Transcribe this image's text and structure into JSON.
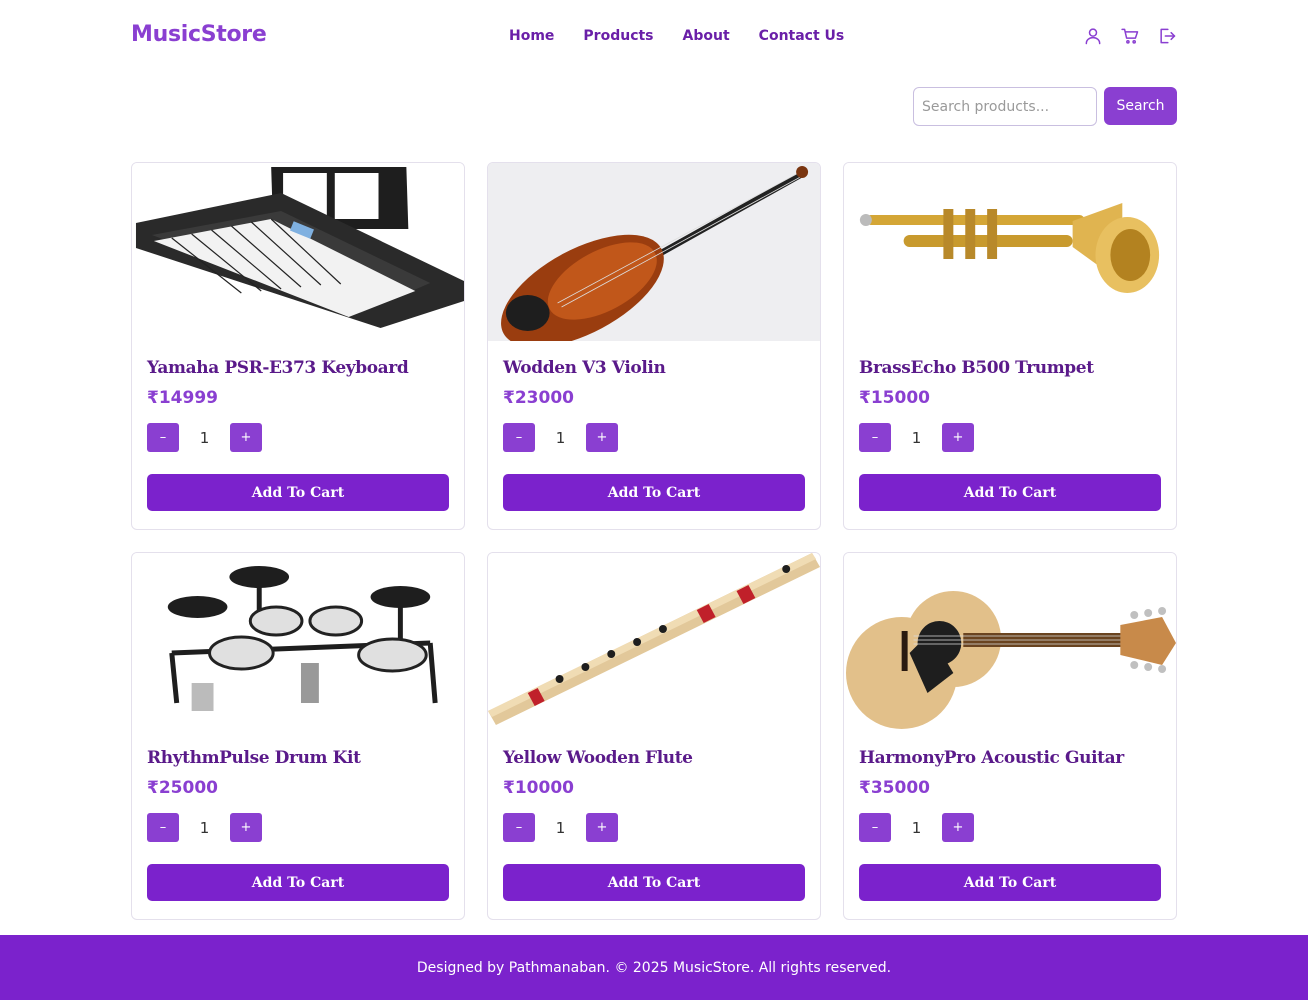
{
  "brand": "MusicStore",
  "nav": {
    "links": [
      "Home",
      "Products",
      "About",
      "Contact Us"
    ]
  },
  "icons": [
    "user-icon",
    "cart-icon",
    "logout-icon"
  ],
  "search": {
    "placeholder": "Search products...",
    "value": "",
    "button_label": "Search"
  },
  "products": [
    {
      "name": "Yamaha PSR-E373 Keyboard",
      "price": "₹14999",
      "qty": "1",
      "add_label": "Add To Cart",
      "image": "keyboard"
    },
    {
      "name": "Wodden V3 Violin",
      "price": "₹23000",
      "qty": "1",
      "add_label": "Add To Cart",
      "image": "violin"
    },
    {
      "name": "BrassEcho B500 Trumpet",
      "price": "₹15000",
      "qty": "1",
      "add_label": "Add To Cart",
      "image": "trumpet"
    },
    {
      "name": "RhythmPulse Drum Kit",
      "price": "₹25000",
      "qty": "1",
      "add_label": "Add To Cart",
      "image": "drum-kit"
    },
    {
      "name": "Yellow Wooden Flute",
      "price": "₹10000",
      "qty": "1",
      "add_label": "Add To Cart",
      "image": "flute"
    },
    {
      "name": "HarmonyPro Acoustic Guitar",
      "price": "₹35000",
      "qty": "1",
      "add_label": "Add To Cart",
      "image": "guitar"
    }
  ],
  "qty_controls": {
    "minus": "–",
    "plus": "+"
  },
  "footer": {
    "text": "Designed by Pathmanaban. © 2025 MusicStore. All rights reserved."
  },
  "colors": {
    "accent": "#8a3fd1",
    "button": "#7b22cc",
    "title": "#5a1a8a",
    "nav_link": "#6a1fa8"
  }
}
